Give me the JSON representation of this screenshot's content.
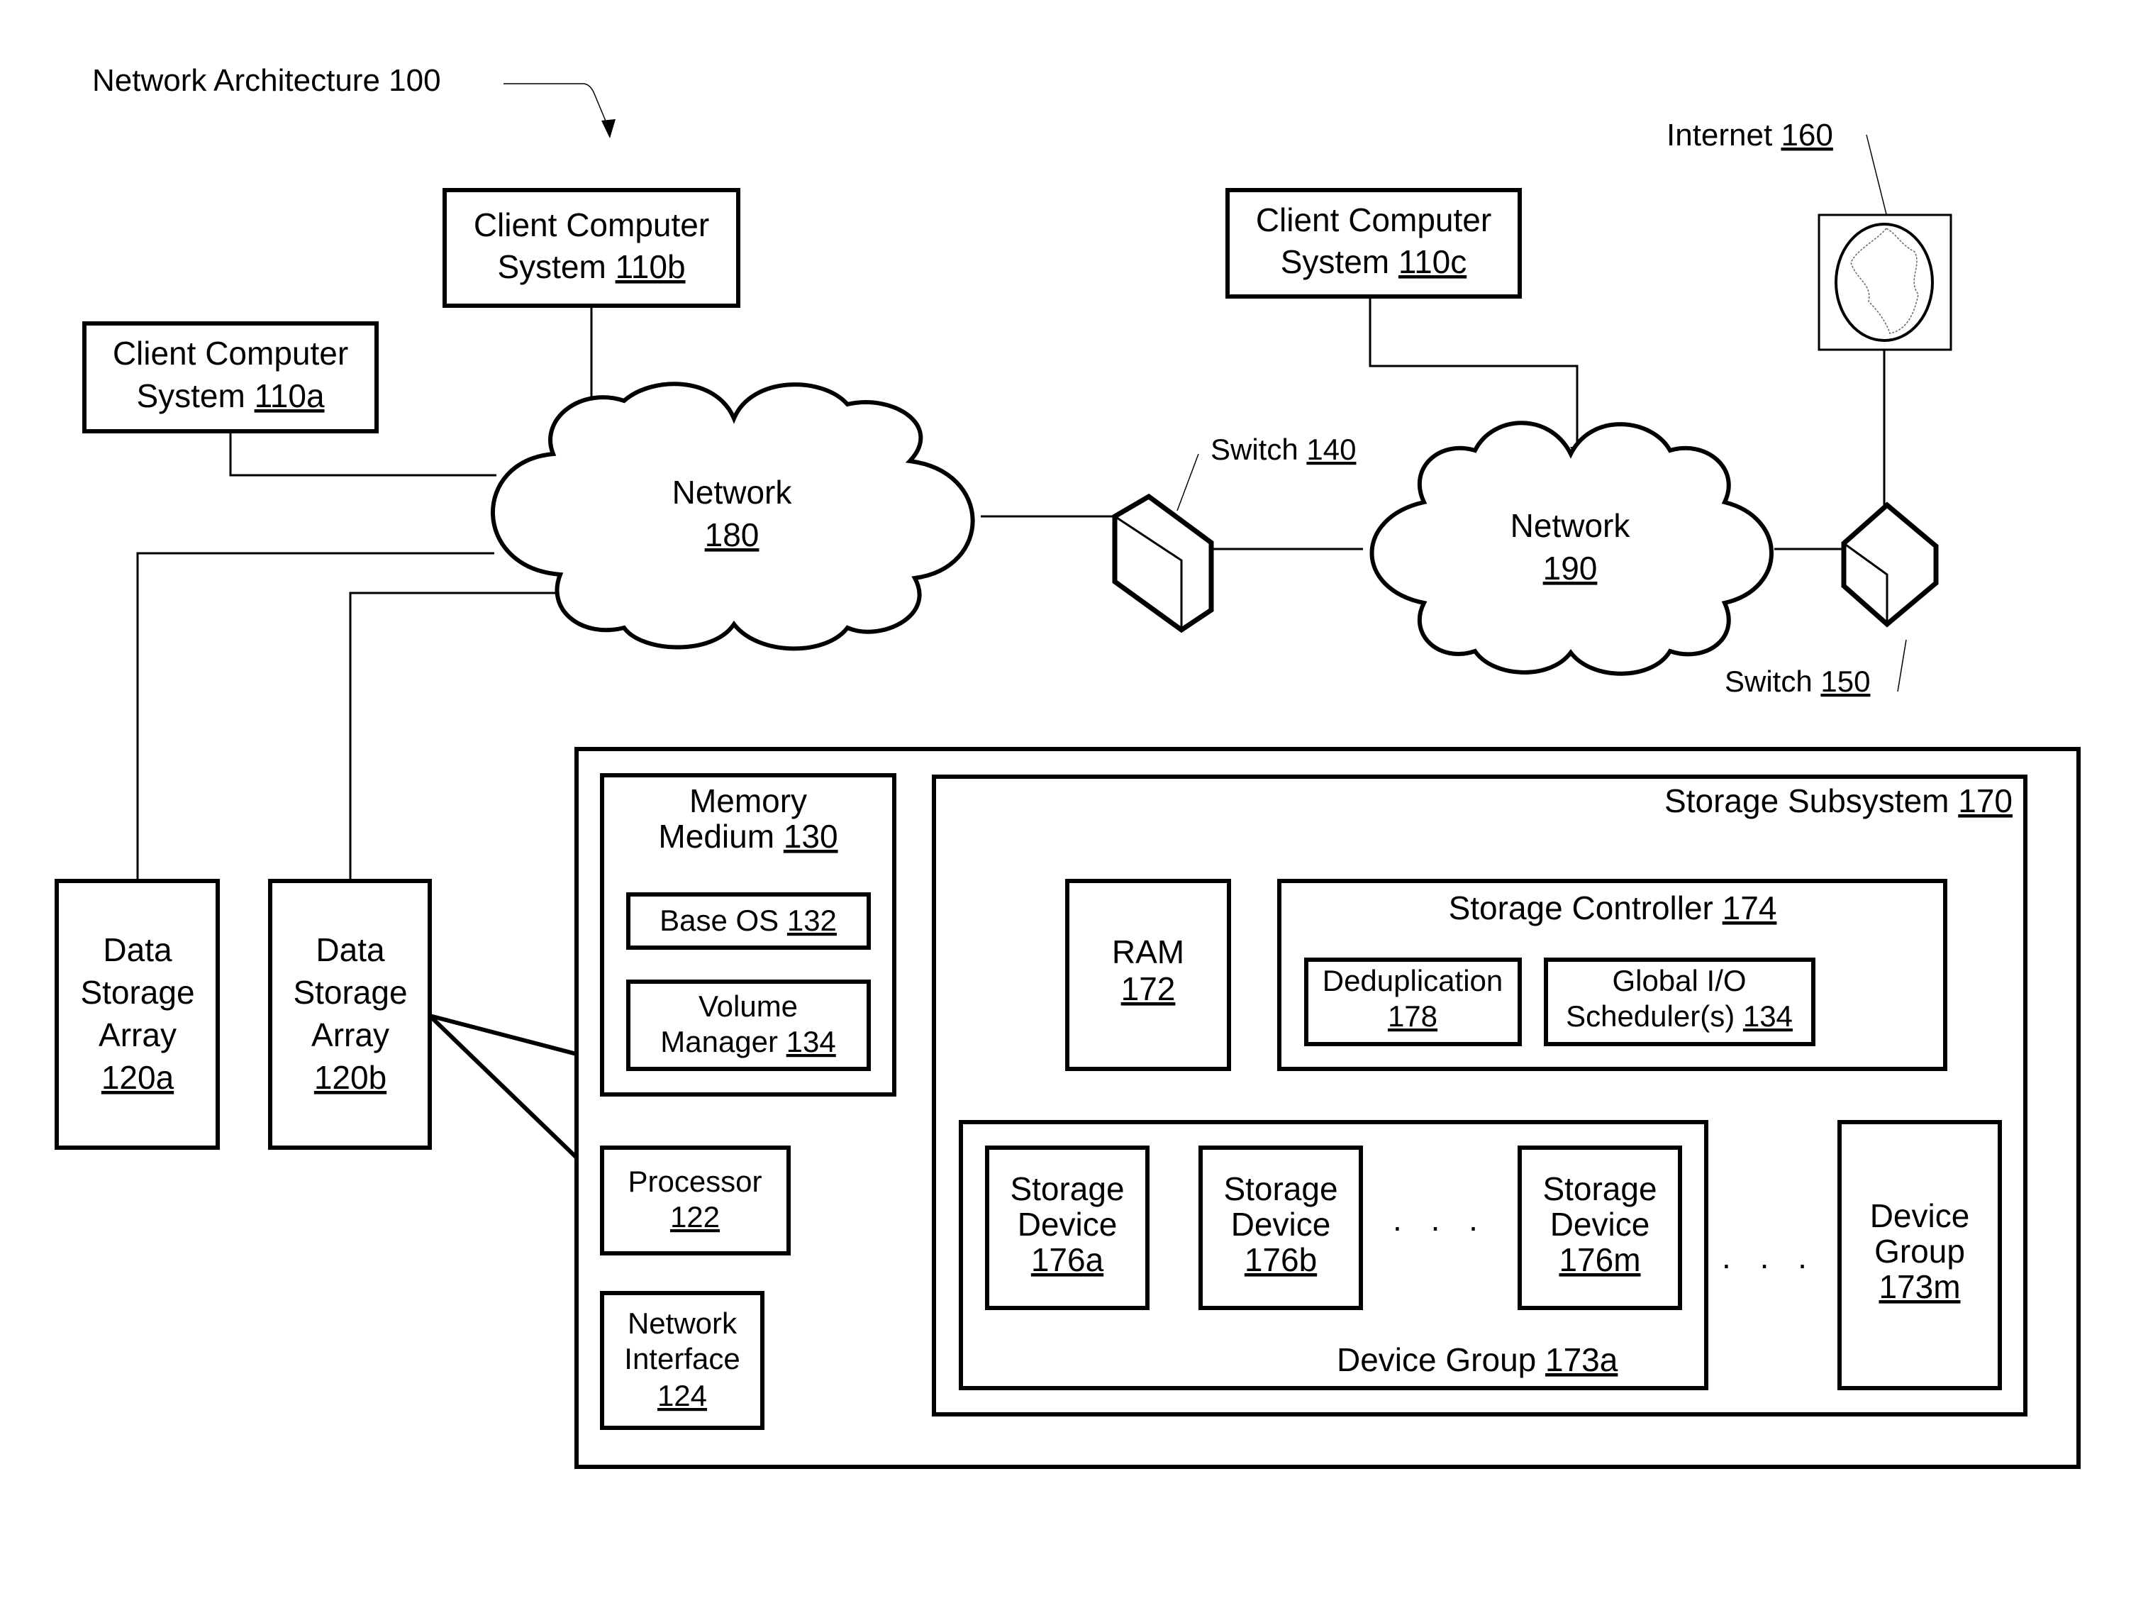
{
  "figure": {
    "title": "Network Architecture 100"
  },
  "clients": [
    {
      "line1": "Client Computer",
      "line2": "System ",
      "ref": "110a"
    },
    {
      "line1": "Client Computer",
      "line2": "System ",
      "ref": "110b"
    },
    {
      "line1": "Client Computer",
      "line2": "System ",
      "ref": "110c"
    }
  ],
  "networks": [
    {
      "label": "Network",
      "ref": "180"
    },
    {
      "label": "Network",
      "ref": "190"
    }
  ],
  "switches": [
    {
      "label": "Switch ",
      "ref": "140"
    },
    {
      "label": "Switch ",
      "ref": "150"
    }
  ],
  "internet": {
    "label": "Internet ",
    "ref": "160"
  },
  "arrays": [
    {
      "l1": "Data",
      "l2": "Storage",
      "l3": "Array",
      "ref": "120a"
    },
    {
      "l1": "Data",
      "l2": "Storage",
      "l3": "Array",
      "ref": "120b"
    }
  ],
  "memory": {
    "l1": "Memory",
    "l2": "Medium ",
    "ref": "130",
    "base_os": {
      "label": "Base OS ",
      "ref": "132"
    },
    "volume_manager": {
      "l1": "Volume",
      "l2": "Manager ",
      "ref": "134"
    }
  },
  "processor": {
    "label": "Processor",
    "ref": "122"
  },
  "network_interface": {
    "l1": "Network",
    "l2": "Interface",
    "ref": "124"
  },
  "storage_subsystem": {
    "label": "Storage Subsystem ",
    "ref": "170",
    "ram": {
      "label": "RAM",
      "ref": "172"
    },
    "controller": {
      "label": "Storage Controller ",
      "ref": "174",
      "dedup": {
        "label": "Deduplication",
        "ref": "178"
      },
      "scheduler": {
        "l1": "Global I/O",
        "l2": "Scheduler(s) ",
        "ref": "134"
      }
    },
    "device_group_a": {
      "label": "Device Group ",
      "ref": "173a",
      "devices": [
        {
          "l1": "Storage",
          "l2": "Device",
          "ref": "176a"
        },
        {
          "l1": "Storage",
          "l2": "Device",
          "ref": "176b"
        },
        {
          "l1": "Storage",
          "l2": "Device",
          "ref": "176m"
        }
      ],
      "ellipsis": ". . ."
    },
    "group_ellipsis": ". . .",
    "device_group_m": {
      "l1": "Device",
      "l2": "Group",
      "ref": "173m"
    }
  }
}
